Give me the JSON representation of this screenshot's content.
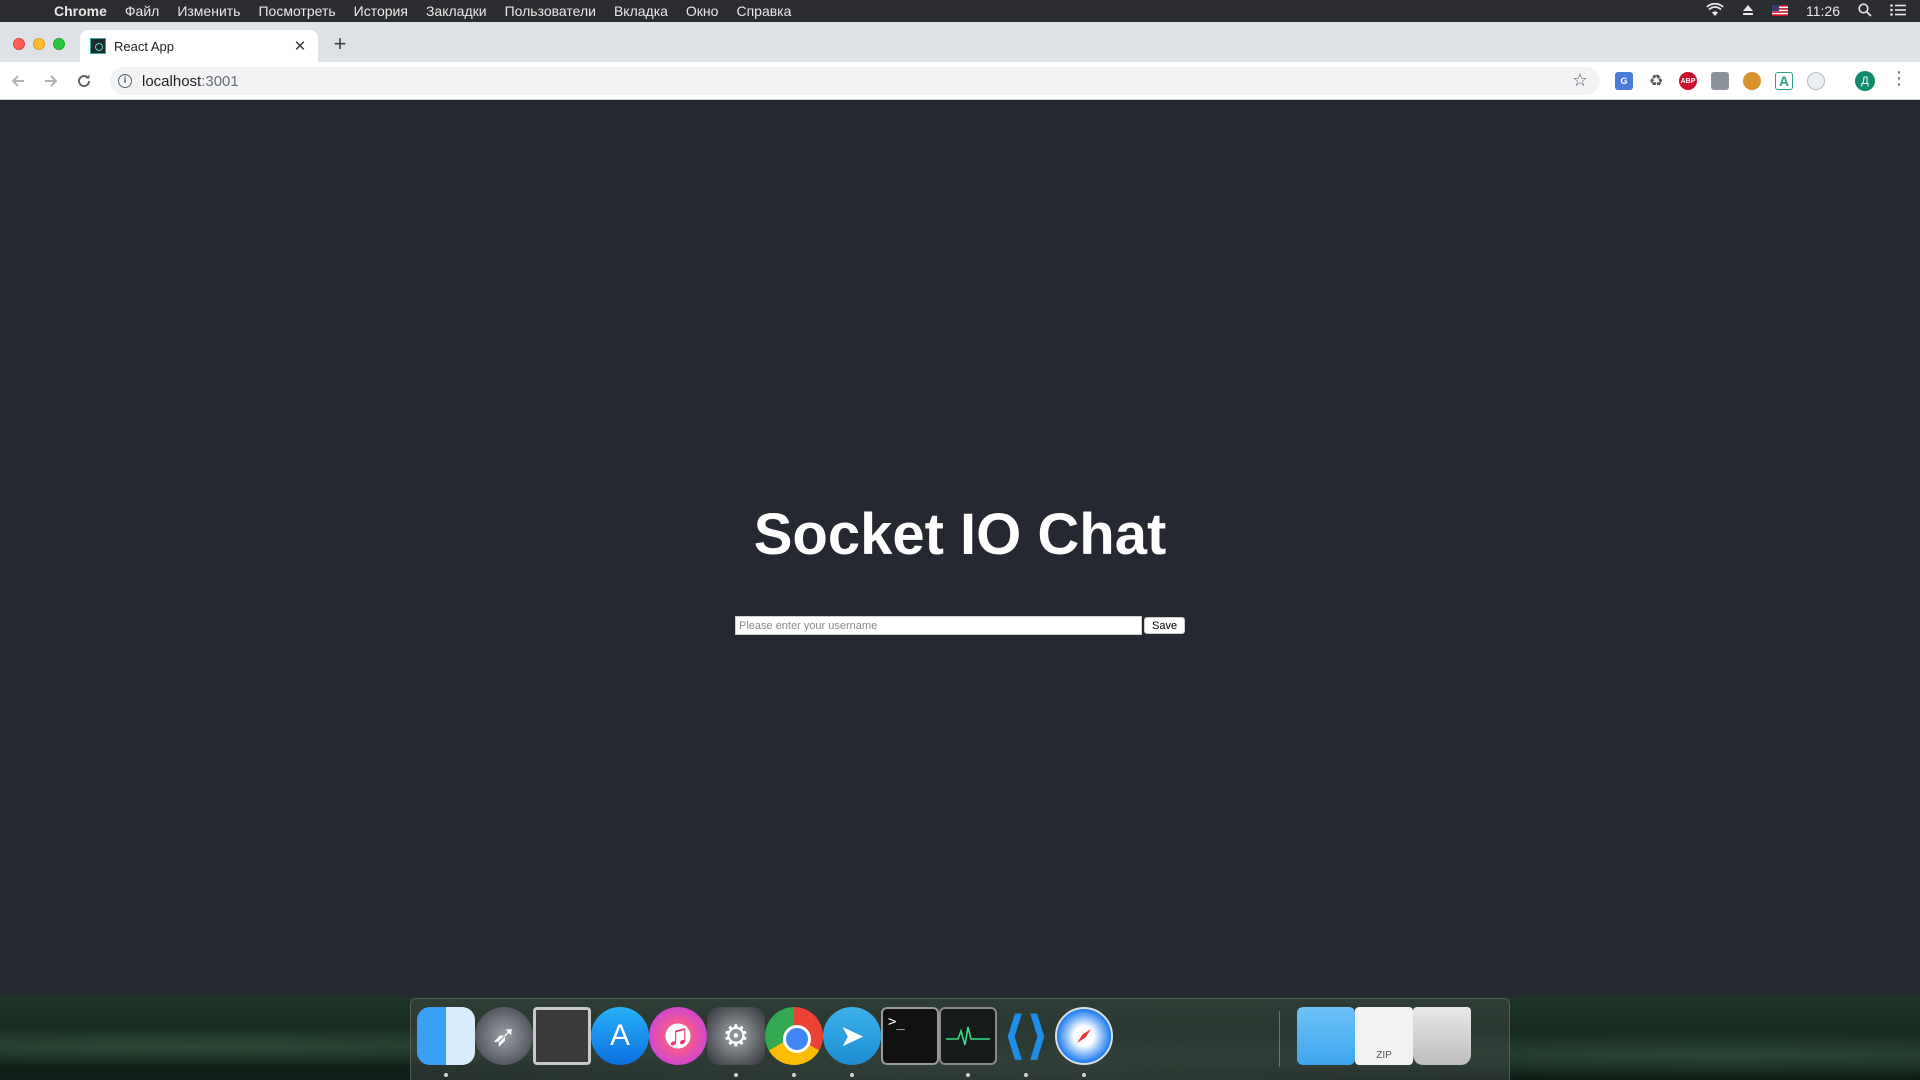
{
  "menubar": {
    "app_name": "Chrome",
    "items": [
      "Файл",
      "Изменить",
      "Посмотреть",
      "История",
      "Закладки",
      "Пользователи",
      "Вкладка",
      "Окно",
      "Справка"
    ],
    "time": "11:26"
  },
  "browser": {
    "tab_title": "React App",
    "url_host": "localhost",
    "url_port": ":3001"
  },
  "page": {
    "heading": "Socket IO Chat",
    "username_placeholder": "Please enter your username",
    "save_label": "Save"
  },
  "dock": {
    "apps": [
      "finder",
      "launchpad",
      "photo-slideshow",
      "app-store",
      "itunes",
      "system-preferences",
      "chrome",
      "telegram",
      "terminal",
      "activity-monitor",
      "vscode",
      "safari",
      "downloads-folder",
      "zip-archive",
      "trash"
    ]
  },
  "colors": {
    "page_background": "#252830",
    "heading": "#ffffff",
    "tabstrip": "#dee1e6"
  }
}
